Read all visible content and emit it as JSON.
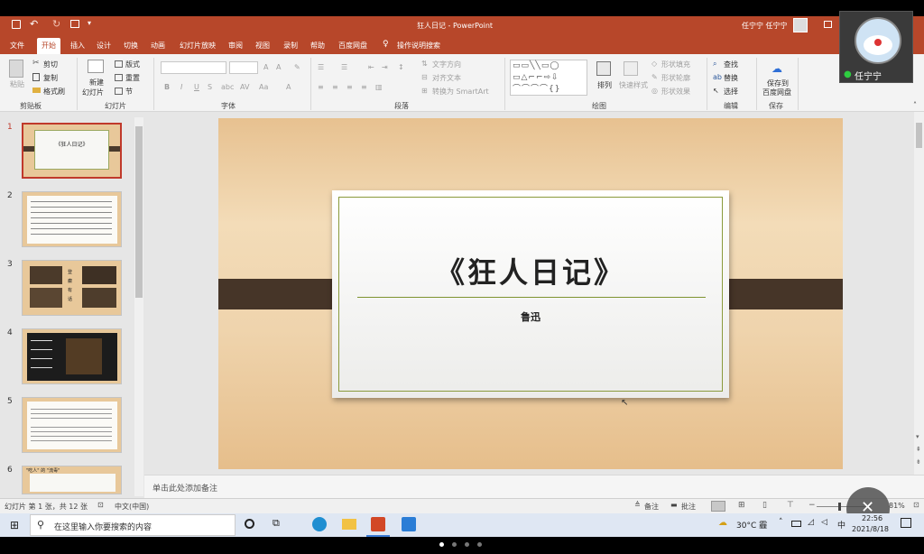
{
  "window": {
    "title": "狂人日记 - PowerPoint",
    "user": "任宁宁 任宁宁"
  },
  "menu": [
    "文件",
    "开始",
    "插入",
    "设计",
    "切换",
    "动画",
    "幻灯片放映",
    "审阅",
    "视图",
    "录制",
    "帮助",
    "百度网盘",
    "操作说明搜索"
  ],
  "ribbon": {
    "paste": "粘贴",
    "cut": "剪切",
    "copy": "复制",
    "format_painter": "格式刷",
    "clipboard_label": "剪贴板",
    "new_slide_1": "新建",
    "new_slide_2": "幻灯片",
    "layout": "版式",
    "reset": "重置",
    "section": "节",
    "slides_label": "幻灯片",
    "font_label": "字体",
    "text_direction": "文字方向",
    "align_text": "对齐文本",
    "smartart": "转换为 SmartArt",
    "paragraph_label": "段落",
    "arrange": "排列",
    "quick_styles": "快速样式",
    "shape_fill": "形状填充",
    "shape_outline": "形状轮廓",
    "shape_effects": "形状效果",
    "drawing_label": "绘图",
    "find": "查找",
    "replace": "替换",
    "select": "选择",
    "editing_label": "编辑",
    "save_1": "保存到",
    "save_2": "百度网盘",
    "save_label": "保存",
    "font_buttons": [
      "B",
      "I",
      "U",
      "S",
      "abc",
      "AV",
      "Aa",
      "A"
    ]
  },
  "video": {
    "user": "任宁宁"
  },
  "thumbnails": [
    {
      "num": "1",
      "title": "《狂人日记》",
      "selected": true
    },
    {
      "num": "2"
    },
    {
      "num": "3",
      "title": "登 癫 有 话"
    },
    {
      "num": "4"
    },
    {
      "num": "5"
    },
    {
      "num": "6",
      "title": "\"吃人\" 的 \"流毒\""
    }
  ],
  "slide": {
    "title": "《狂人日记》",
    "author": "鲁迅"
  },
  "notes_placeholder": "单击此处添加备注",
  "status": {
    "slide_info": "幻灯片 第 1 张，共 12 张",
    "language": "中文(中国)",
    "notes": "备注",
    "comments": "批注",
    "zoom": "81%"
  },
  "taskbar": {
    "search_placeholder": "在这里输入你要搜索的内容",
    "weather": "30°C 霾",
    "ime": "中",
    "time": "22:56",
    "date": "2021/8/18"
  },
  "colors": {
    "accent": "#b7472a",
    "taskbar": "#dfe7f3",
    "selection": "#c0392b"
  }
}
